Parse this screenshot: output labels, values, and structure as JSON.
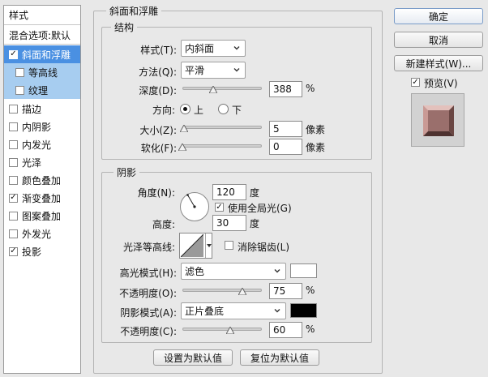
{
  "left_panel": {
    "header": "样式",
    "blend_options": "混合选项:默认",
    "items": [
      {
        "label": "斜面和浮雕",
        "checked": true
      },
      {
        "label": "等高线",
        "checked": false
      },
      {
        "label": "纹理",
        "checked": false
      },
      {
        "label": "描边",
        "checked": false
      },
      {
        "label": "内阴影",
        "checked": false
      },
      {
        "label": "内发光",
        "checked": false
      },
      {
        "label": "光泽",
        "checked": false
      },
      {
        "label": "颜色叠加",
        "checked": false
      },
      {
        "label": "渐变叠加",
        "checked": true
      },
      {
        "label": "图案叠加",
        "checked": false
      },
      {
        "label": "外发光",
        "checked": false
      },
      {
        "label": "投影",
        "checked": true
      }
    ]
  },
  "bevel": {
    "title": "斜面和浮雕",
    "structure": {
      "title": "结构",
      "style_label": "样式(T):",
      "style_value": "内斜面",
      "technique_label": "方法(Q):",
      "technique_value": "平滑",
      "depth_label": "深度(D):",
      "depth_value": "388",
      "depth_fraction": 0.39,
      "percent": "%",
      "direction_label": "方向:",
      "direction_up": "上",
      "direction_down": "下",
      "direction_selected": "上",
      "size_label": "大小(Z):",
      "size_value": "5",
      "size_fraction": 0.02,
      "softness_label": "软化(F):",
      "softness_value": "0",
      "softness_fraction": 0.0,
      "pixels": "像素"
    },
    "shading": {
      "title": "阴影",
      "angle_label": "角度(N):",
      "angle_value": "120",
      "degree": "度",
      "global_light_label": "使用全局光(G)",
      "global_light_checked": true,
      "altitude_label": "高度:",
      "altitude_value": "30",
      "gloss_contour_label": "光泽等高线:",
      "anti_alias_label": "消除锯齿(L)",
      "anti_alias_checked": false,
      "highlight_mode_label": "高光模式(H):",
      "highlight_mode_value": "滤色",
      "highlight_color": "#ffffff",
      "highlight_opacity_label": "不透明度(O):",
      "highlight_opacity_value": "75",
      "highlight_opacity_fraction": 0.75,
      "shadow_mode_label": "阴影模式(A):",
      "shadow_mode_value": "正片叠底",
      "shadow_color": "#000000",
      "shadow_opacity_label": "不透明度(C):",
      "shadow_opacity_value": "60",
      "shadow_opacity_fraction": 0.6
    },
    "make_default": "设置为默认值",
    "reset_default": "复位为默认值"
  },
  "right_panel": {
    "ok": "确定",
    "cancel": "取消",
    "new_style": "新建样式(W)...",
    "preview_label": "预览(V)",
    "preview_checked": true
  },
  "colors": {
    "selection": "#4a90e2",
    "sub_selection": "#a7cdf0",
    "preview_fill": "#9a6f6c"
  }
}
